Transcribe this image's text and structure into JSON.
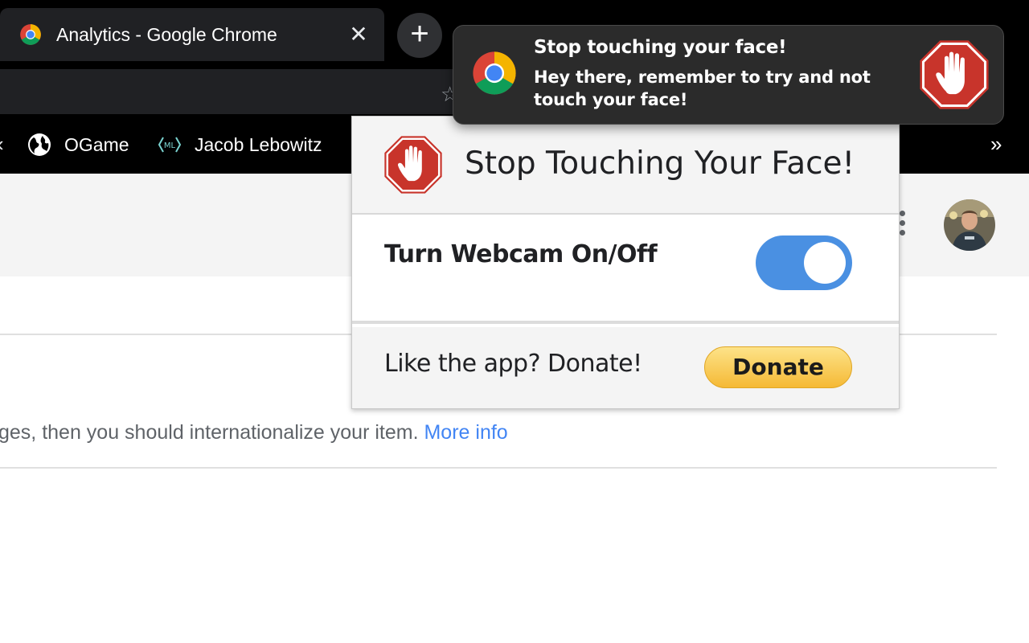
{
  "browser": {
    "tab": {
      "title": "Analytics - Google Chrome",
      "close_glyph": "✕",
      "favicon": "chrome-icon"
    },
    "new_tab_glyph": "+",
    "star_glyph": "☆",
    "bookmarks": [
      {
        "label": "OGame",
        "icon": "globe-icon"
      },
      {
        "label": "Jacob Lebowitz",
        "icon": "ml-icon"
      }
    ],
    "bookmarks_edge_glyph": "‹",
    "bookmarks_more_glyph": "»"
  },
  "page": {
    "content_text": "ges, then you should internationalize your item. ",
    "more_info_link": "More info",
    "link_color": "#4285f4"
  },
  "popup": {
    "title": "Stop Touching Your Face!",
    "webcam_label": "Turn Webcam On/Off",
    "webcam_toggle_on": true,
    "toggle_color": "#4a90e2",
    "donate_label": "Like the app? Donate!",
    "donate_button": "Donate"
  },
  "notification": {
    "title": "Stop touching your face!",
    "body": "Hey there, remember to try and not touch your face!",
    "app_icon": "chrome-icon",
    "image_icon": "stop-hand-icon"
  },
  "colors": {
    "stop_red": "#c8342b",
    "tab_bg": "#202124",
    "notification_bg": "#2b2b2b"
  }
}
